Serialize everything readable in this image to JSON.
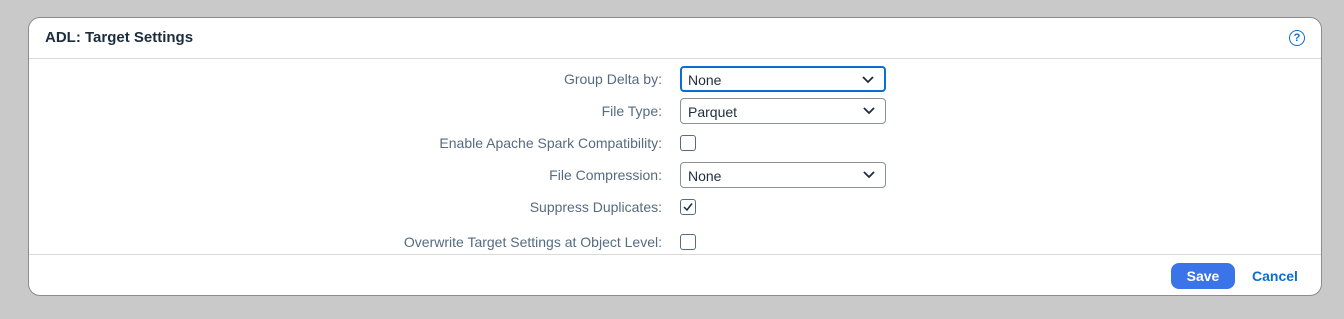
{
  "dialog": {
    "title": "ADL: Target Settings",
    "help_icon": "help-circle-icon"
  },
  "form": {
    "group_delta": {
      "label": "Group Delta by:",
      "value": "None"
    },
    "file_type": {
      "label": "File Type:",
      "value": "Parquet"
    },
    "spark_compat": {
      "label": "Enable Apache Spark Compatibility:",
      "checked": false
    },
    "file_compression": {
      "label": "File Compression:",
      "value": "None"
    },
    "suppress_duplicates": {
      "label": "Suppress Duplicates:",
      "checked": true
    },
    "overwrite_target": {
      "label": "Overwrite Target Settings at Object Level:",
      "checked": false
    }
  },
  "footer": {
    "save_label": "Save",
    "cancel_label": "Cancel"
  },
  "colors": {
    "accent": "#0a6ed1",
    "save_button": "#3b73e8",
    "label_text": "#556b82",
    "title_text": "#1d2d3e"
  }
}
